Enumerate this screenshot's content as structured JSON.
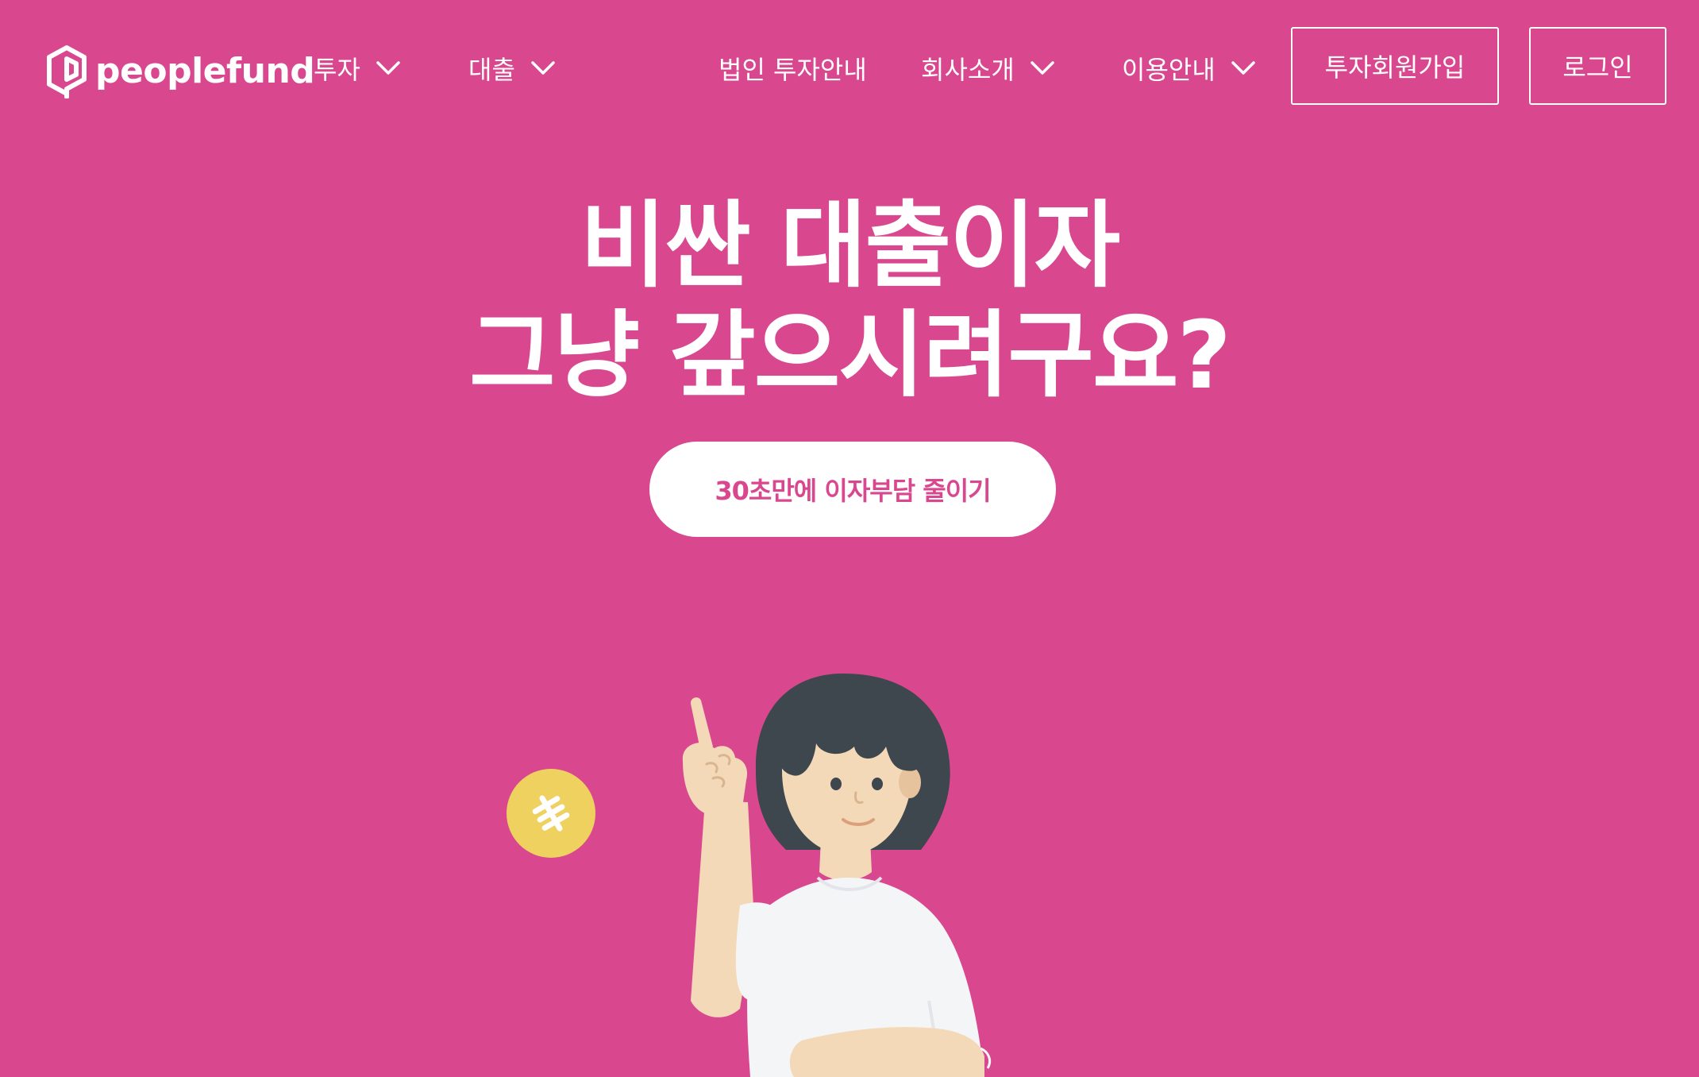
{
  "header": {
    "logo_text": "peoplefund",
    "nav": {
      "invest": "투자",
      "loan": "대출",
      "corporate": "법인 투자안내",
      "company": "회사소개",
      "guide": "이용안내"
    },
    "signup_label": "투자회원가입",
    "login_label": "로그인"
  },
  "hero": {
    "title_line1": "비싼 대출이자",
    "title_line2": "그냥 갚으시려구요?",
    "cta_label": "30초만에 이자부담 줄이기"
  },
  "colors": {
    "background": "#d9478f",
    "text": "#ffffff",
    "coin": "#eed15f",
    "hair": "#3e474d",
    "skin": "#f3d9b8",
    "shirt": "#f4f5f7"
  },
  "icons": {
    "logo": "peoplefund-logo-icon",
    "dropdown": "chevron-down-icon",
    "coin": "won-coin-icon"
  }
}
